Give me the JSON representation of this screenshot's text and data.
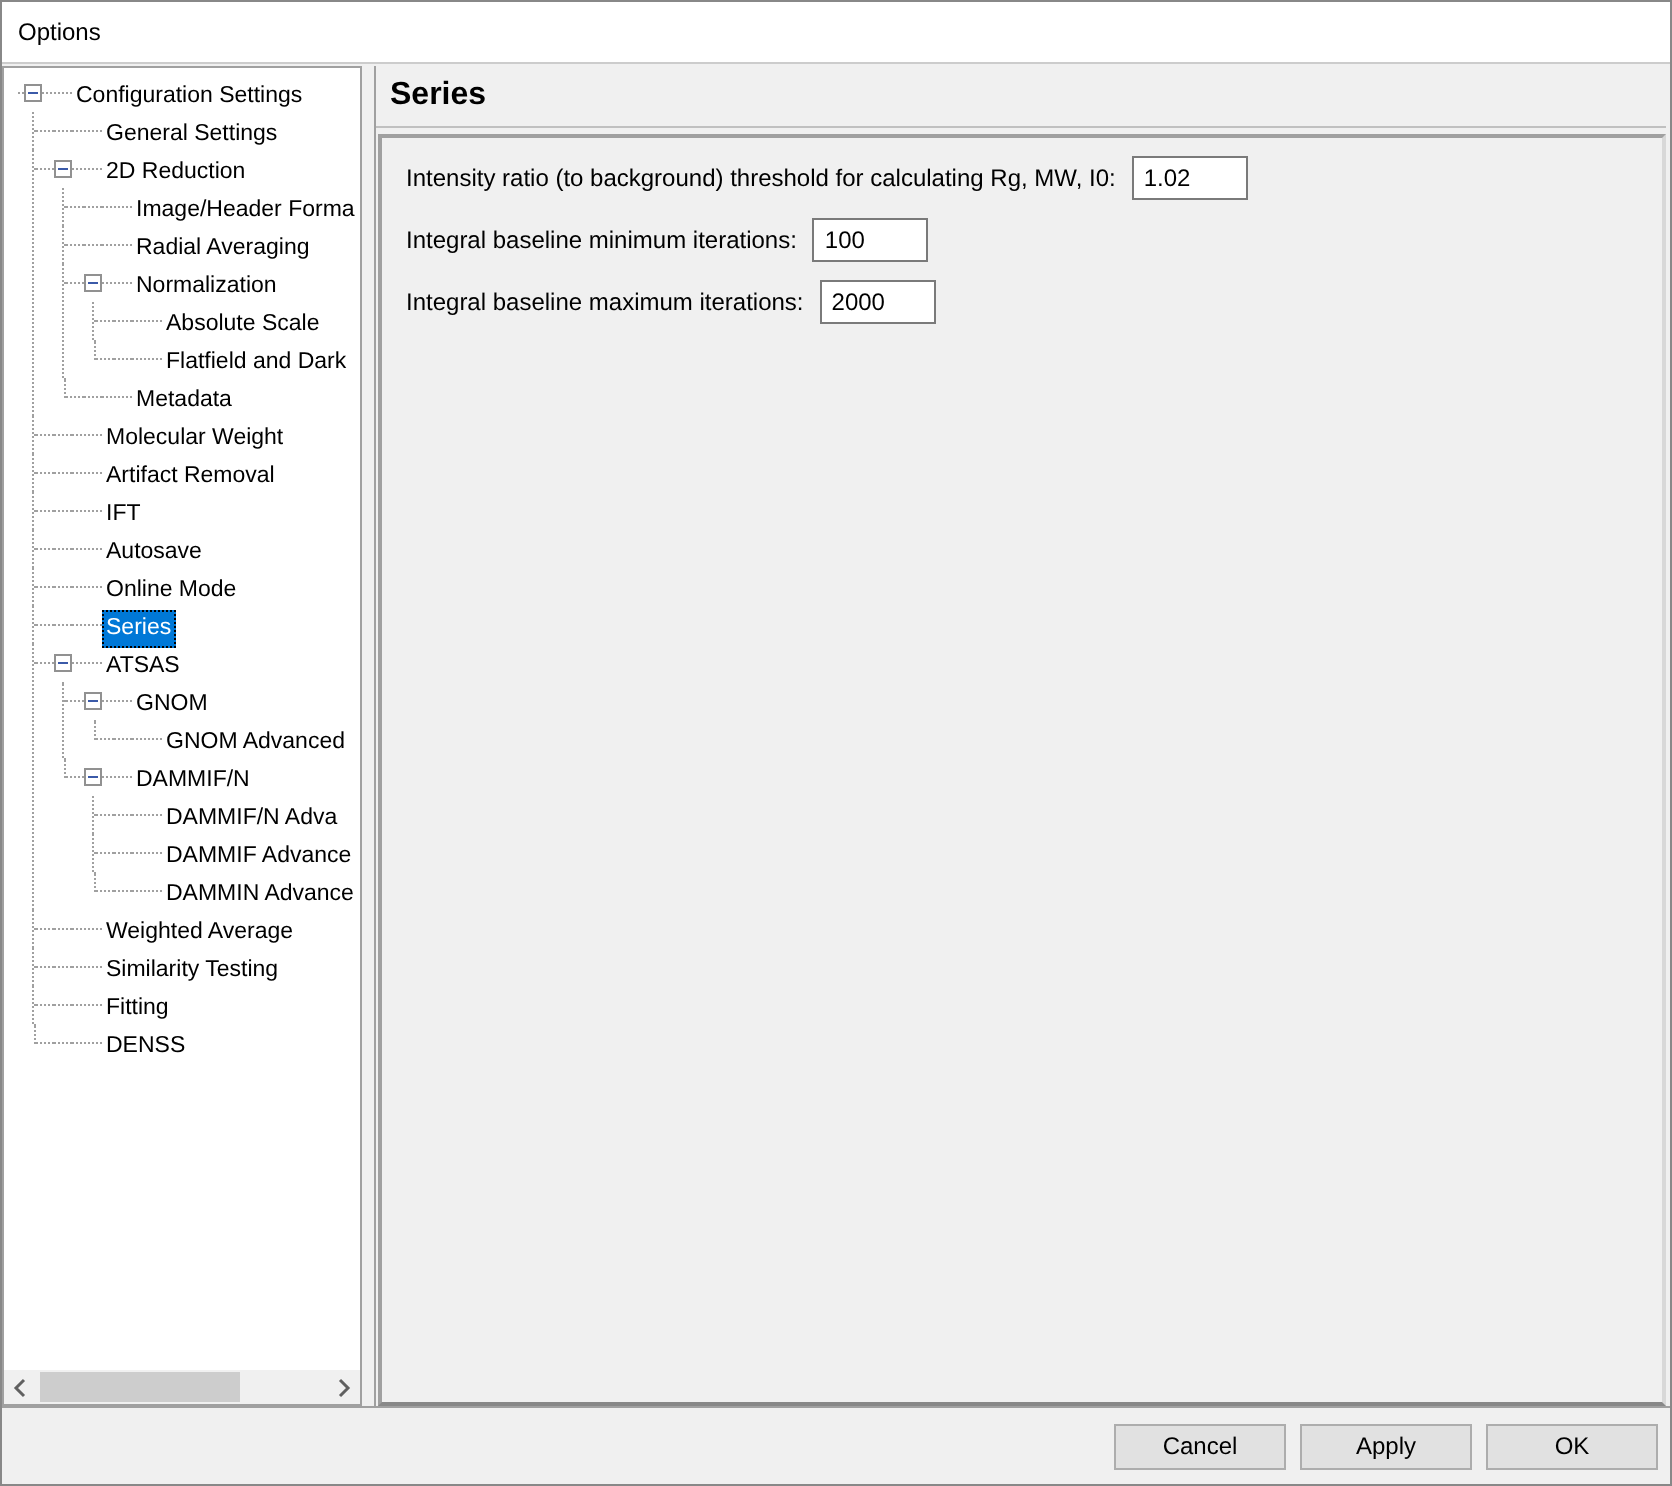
{
  "window": {
    "title": "Options"
  },
  "tree": {
    "items": [
      {
        "label": "Configuration Settings",
        "selected": false,
        "expanded": true,
        "children": [
          {
            "label": "General Settings",
            "selected": false
          },
          {
            "label": "2D Reduction",
            "selected": false,
            "expanded": true,
            "children": [
              {
                "label": "Image/Header Forma",
                "selected": false
              },
              {
                "label": "Radial Averaging",
                "selected": false
              },
              {
                "label": "Normalization",
                "selected": false,
                "expanded": true,
                "children": [
                  {
                    "label": "Absolute Scale",
                    "selected": false
                  },
                  {
                    "label": "Flatfield and Dark",
                    "selected": false
                  }
                ]
              },
              {
                "label": "Metadata",
                "selected": false
              }
            ]
          },
          {
            "label": "Molecular Weight",
            "selected": false
          },
          {
            "label": "Artifact Removal",
            "selected": false
          },
          {
            "label": "IFT",
            "selected": false
          },
          {
            "label": "Autosave",
            "selected": false
          },
          {
            "label": "Online Mode",
            "selected": false
          },
          {
            "label": "Series",
            "selected": true
          },
          {
            "label": "ATSAS",
            "selected": false,
            "expanded": true,
            "children": [
              {
                "label": "GNOM",
                "selected": false,
                "expanded": true,
                "children": [
                  {
                    "label": "GNOM Advanced",
                    "selected": false
                  }
                ]
              },
              {
                "label": "DAMMIF/N",
                "selected": false,
                "expanded": true,
                "children": [
                  {
                    "label": "DAMMIF/N Adva",
                    "selected": false
                  },
                  {
                    "label": "DAMMIF Advance",
                    "selected": false
                  },
                  {
                    "label": "DAMMIN Advance",
                    "selected": false
                  }
                ]
              }
            ]
          },
          {
            "label": "Weighted Average",
            "selected": false
          },
          {
            "label": "Similarity Testing",
            "selected": false
          },
          {
            "label": "Fitting",
            "selected": false
          },
          {
            "label": "DENSS",
            "selected": false
          }
        ]
      }
    ]
  },
  "panel": {
    "title": "Series",
    "fields": [
      {
        "label": "Intensity ratio (to background) threshold for calculating Rg, MW, I0:",
        "value": "1.02"
      },
      {
        "label": "Integral baseline minimum iterations:",
        "value": "100"
      },
      {
        "label": "Integral baseline maximum iterations:",
        "value": "2000"
      }
    ]
  },
  "buttons": [
    "Cancel",
    "Apply",
    "OK"
  ]
}
